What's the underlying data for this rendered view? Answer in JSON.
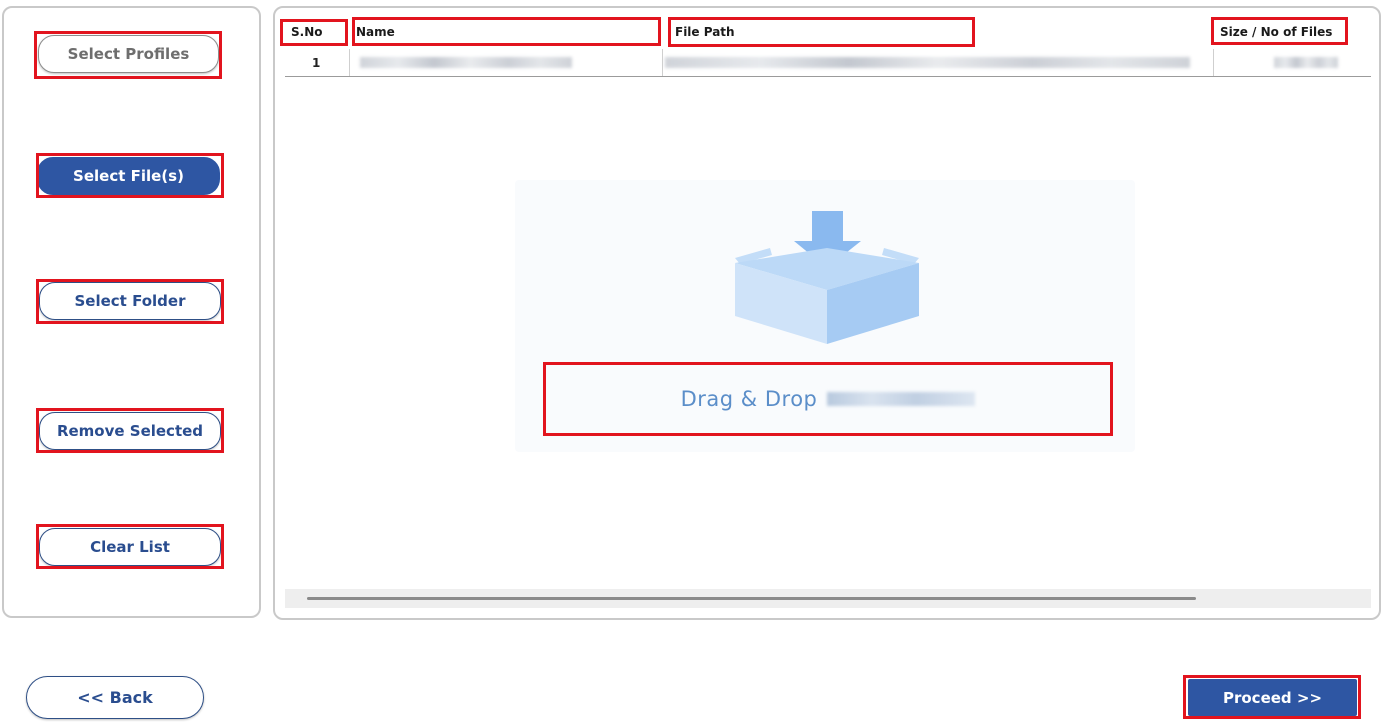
{
  "left_panel": {
    "select_profiles_label": "Select Profiles",
    "select_files_label": "Select File(s)",
    "select_folder_label": "Select Folder",
    "remove_selected_label": "Remove Selected",
    "clear_list_label": "Clear List"
  },
  "table": {
    "columns": [
      "S.No",
      "Name",
      "File Path",
      "Size / No of Files"
    ],
    "rows": [
      {
        "sno": "1"
      }
    ]
  },
  "drop_zone": {
    "label": "Drag & Drop"
  },
  "footer": {
    "back_label": "<< Back",
    "proceed_label": "Proceed >>"
  },
  "colors": {
    "primary": "#2e56a3",
    "highlight": "#e2141e",
    "drop_text": "#5b8ec9",
    "icon_blue": "#a9cdf5"
  }
}
